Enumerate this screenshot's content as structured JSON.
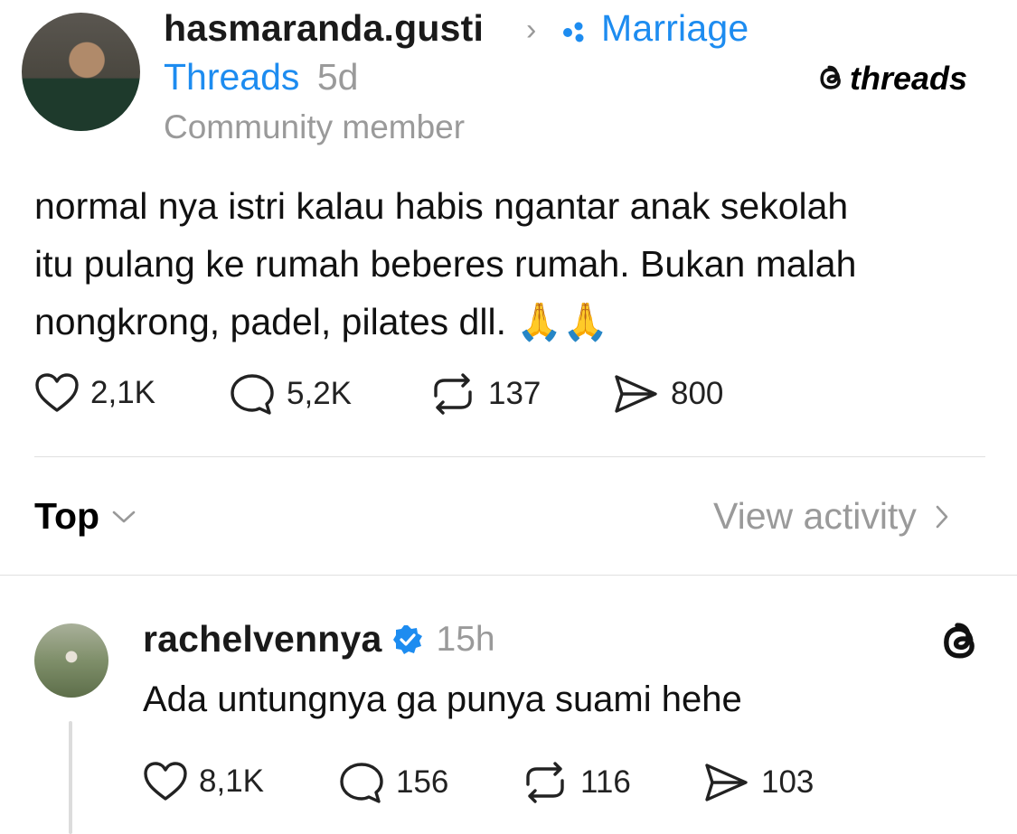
{
  "post": {
    "username": "hasmaranda.gusti",
    "separator": "›",
    "community_line1": "Marriage",
    "community_line2": "Threads",
    "age": "5d",
    "role": "Community member",
    "text_line1": "normal nya istri kalau habis ngantar anak sekolah",
    "text_line2": "itu pulang ke rumah beberes rumah. Bukan malah",
    "text_line3": "nongkrong, padel, pilates dll. 🙏🙏",
    "likes": "2,1K",
    "comments": "5,2K",
    "reposts": "137",
    "shares": "800"
  },
  "brand": {
    "wordmark": "threads",
    "accent_color": "#1d8cf0"
  },
  "sort": {
    "label": "Top",
    "view_activity": "View activity"
  },
  "reply": {
    "username": "rachelvennya",
    "verified": true,
    "age": "15h",
    "text": "Ada untungnya ga punya suami hehe",
    "likes": "8,1K",
    "comments": "156",
    "reposts": "116",
    "shares": "103"
  },
  "icons": {
    "like": "heart-icon",
    "comment": "comment-icon",
    "repost": "repost-icon",
    "share": "share-icon",
    "verified": "verified-badge-icon",
    "threads_logo": "threads-logo-icon"
  }
}
